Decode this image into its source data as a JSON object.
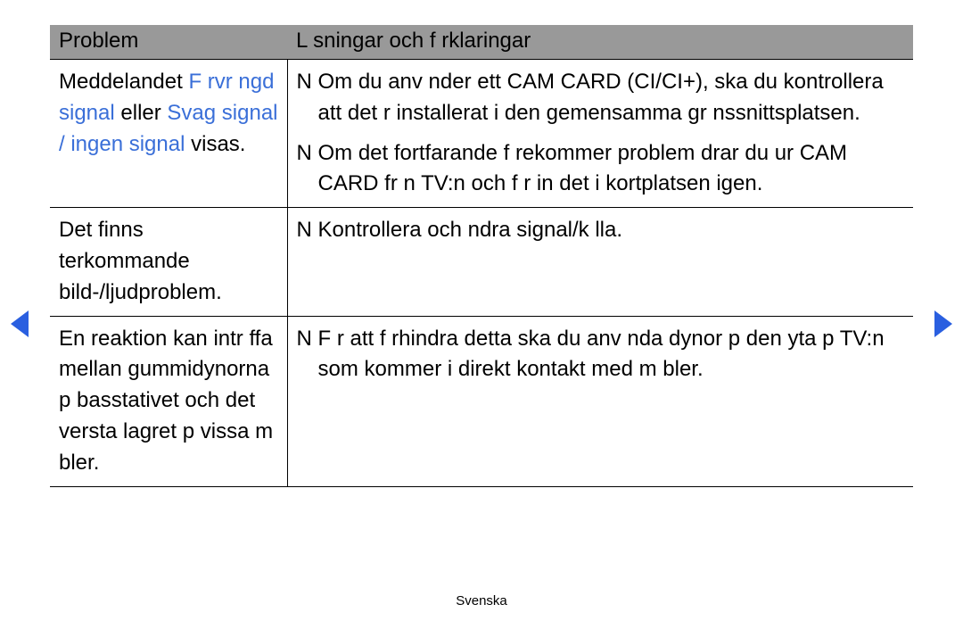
{
  "header": {
    "col1": "Problem",
    "col2": "L sningar och f rklaringar"
  },
  "rows": [
    {
      "problem": {
        "pre": "Meddelandet ",
        "blue1": "F rvr ngd signal",
        "mid": " eller ",
        "blue2": "Svag signal / ingen signal",
        "post": " visas."
      },
      "solutions": [
        "Om du anv nder ett CAM CARD (CI/CI+), ska du kontrollera att det  r installerat i den gemensamma gr nssnittsplatsen.",
        "Om det fortfarande f rekommer problem drar du ur CAM CARD fr n TV:n och f r in det i kortplatsen igen."
      ]
    },
    {
      "problem": {
        "text": "Det finns  terkommande bild-/ljudproblem."
      },
      "solutions": [
        "Kontrollera och  ndra signal/k lla."
      ]
    },
    {
      "problem": {
        "text": "En reaktion kan intr ffa mellan gummidynorna p  basstativet och det  versta lagret p  vissa m bler."
      },
      "solutions": [
        "F r att f rhindra detta ska du anv nda dynor p  den yta p  TV:n som kommer i direkt kontakt med m bler."
      ]
    }
  ],
  "footer": "Svenska"
}
